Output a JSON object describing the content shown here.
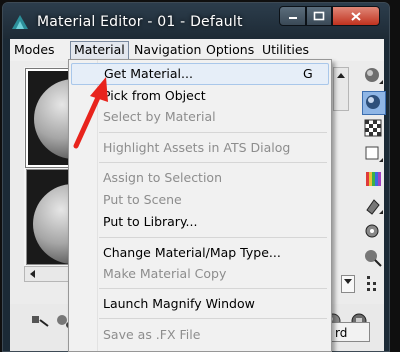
{
  "window": {
    "title": "Material Editor - 01 - Default"
  },
  "menubar": {
    "items": [
      "Modes",
      "Material",
      "Navigation",
      "Options",
      "Utilities"
    ]
  },
  "dropdown": {
    "items": [
      {
        "label": "Get Material...",
        "shortcut": "G",
        "enabled": true,
        "highlighted": true
      },
      {
        "label": "Pick from Object",
        "enabled": true
      },
      {
        "label": "Select by Material",
        "enabled": false
      },
      {
        "label": "Highlight Assets in ATS Dialog",
        "enabled": false
      },
      {
        "label": "Assign to Selection",
        "enabled": false
      },
      {
        "label": "Put to Scene",
        "enabled": false
      },
      {
        "label": "Put to Library...",
        "enabled": true
      },
      {
        "label": "Change Material/Map Type...",
        "enabled": true
      },
      {
        "label": "Make Material Copy",
        "enabled": false
      },
      {
        "label": "Launch Magnify Window",
        "enabled": true
      },
      {
        "label": "Save as .FX File",
        "enabled": false
      }
    ]
  },
  "bottom": {
    "button_partial_label": "rd"
  },
  "annotation": {
    "arrow_color": "#e8231c"
  },
  "icons": {
    "app": "3dsmax-icon",
    "tools": [
      "sample-type-icon",
      "backlight-icon",
      "background-checker-icon",
      "sample-uv-tiling-icon",
      "video-color-check-icon",
      "make-preview-icon",
      "options-icon",
      "select-by-material-icon",
      "material-map-navigator-icon"
    ]
  }
}
